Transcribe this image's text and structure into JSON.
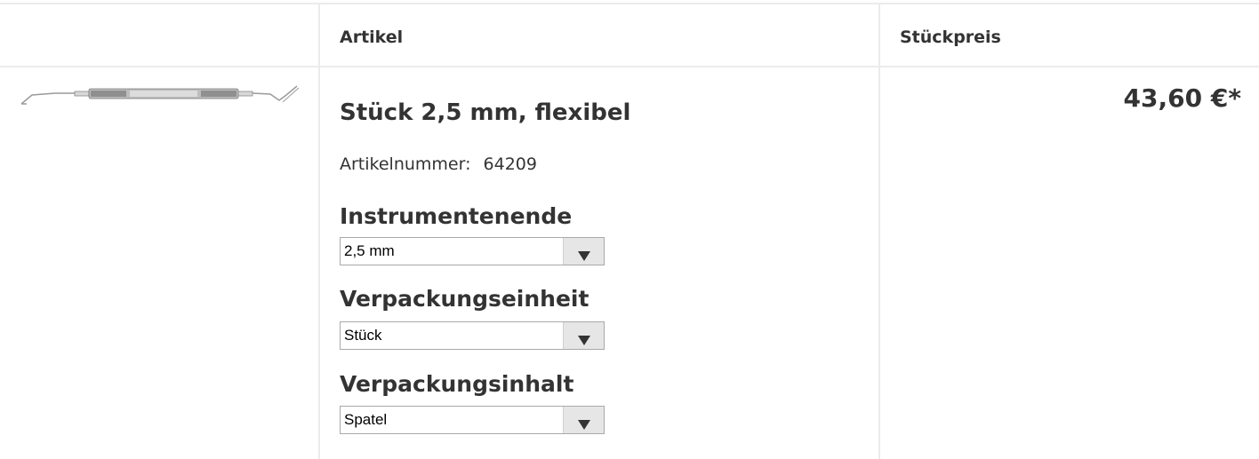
{
  "header": {
    "article_col": "Artikel",
    "price_col": "Stückpreis"
  },
  "product": {
    "image_icon": "dental-instrument-image",
    "title": "Stück 2,5 mm, flexibel",
    "article_number_label": "Artikelnummer:",
    "article_number": "64209",
    "price": "43,60 €*"
  },
  "options": [
    {
      "label": "Instrumentenende",
      "selected": "2,5 mm"
    },
    {
      "label": "Verpackungseinheit",
      "selected": "Stück"
    },
    {
      "label": "Verpackungsinhalt",
      "selected": "Spatel"
    }
  ],
  "colors": {
    "border": "#ebebeb",
    "text": "#333333",
    "select_button": "#e6e6e6"
  }
}
